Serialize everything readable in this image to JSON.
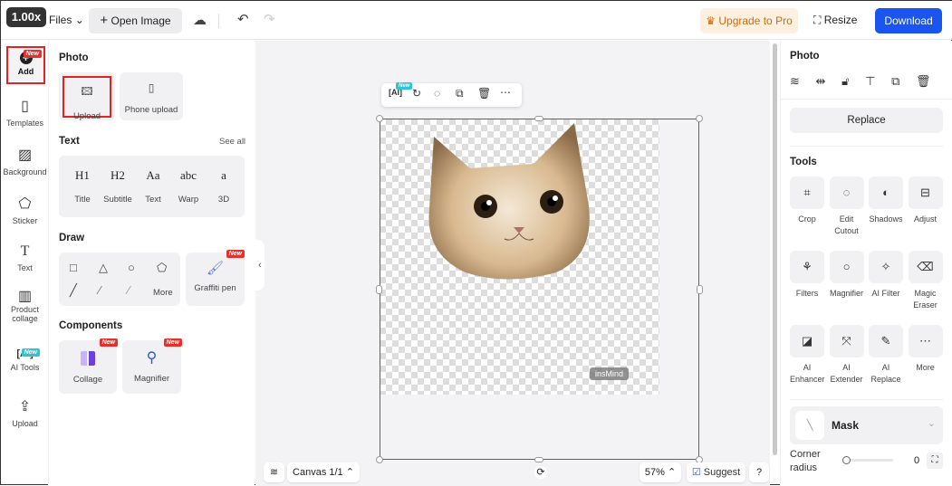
{
  "topbar": {
    "zoom_tag": "1.00x",
    "files": "Files",
    "open_image": "Open Image",
    "upgrade": "Upgrade to Pro",
    "resize": "Resize",
    "download": "Download"
  },
  "rail": [
    {
      "label": "Add",
      "badge": "New"
    },
    {
      "label": "Templates"
    },
    {
      "label": "Background"
    },
    {
      "label": "Sticker"
    },
    {
      "label": "Text"
    },
    {
      "label": "Product collage"
    },
    {
      "label": "AI Tools",
      "badge": "New"
    },
    {
      "label": "Upload"
    }
  ],
  "panel": {
    "photo": {
      "title": "Photo",
      "upload": "Upload",
      "phone_upload": "Phone upload"
    },
    "text": {
      "title": "Text",
      "see_all": "See all",
      "items": [
        {
          "glyph": "H1",
          "label": "Title"
        },
        {
          "glyph": "H2",
          "label": "Subtitle"
        },
        {
          "glyph": "Aa",
          "label": "Text"
        },
        {
          "glyph": "abc",
          "label": "Warp"
        },
        {
          "glyph": "a",
          "label": "3D"
        }
      ]
    },
    "draw": {
      "title": "Draw",
      "more": "More",
      "graffiti": "Graffiti pen",
      "badge": "New"
    },
    "components": {
      "title": "Components",
      "collage": "Collage",
      "magnifier": "Magnifier",
      "badge": "New"
    }
  },
  "canvas": {
    "watermark": "insMind",
    "ai_badge": "New",
    "canvas_label": "Canvas 1/1",
    "zoom": "57%",
    "suggest": "Suggest",
    "help": "?"
  },
  "right": {
    "photo_title": "Photo",
    "replace": "Replace",
    "tools_title": "Tools",
    "tools": [
      [
        "Crop",
        ""
      ],
      [
        "Edit",
        "Cutout"
      ],
      [
        "Shadows",
        ""
      ],
      [
        "Adjust",
        ""
      ],
      [
        "Filters",
        ""
      ],
      [
        "Magnifier",
        ""
      ],
      [
        "AI Filter",
        ""
      ],
      [
        "Magic",
        "Eraser"
      ],
      [
        "AI",
        "Enhancer"
      ],
      [
        "AI",
        "Extender"
      ],
      [
        "AI",
        "Replace"
      ],
      [
        "More",
        ""
      ]
    ],
    "mask": "Mask",
    "corner_radius_1": "Corner",
    "corner_radius_2": "radius",
    "corner_value": "0"
  },
  "colors": {
    "accent": "#1a55f0",
    "badge": "#e8302a",
    "highlight": "#e02424"
  }
}
